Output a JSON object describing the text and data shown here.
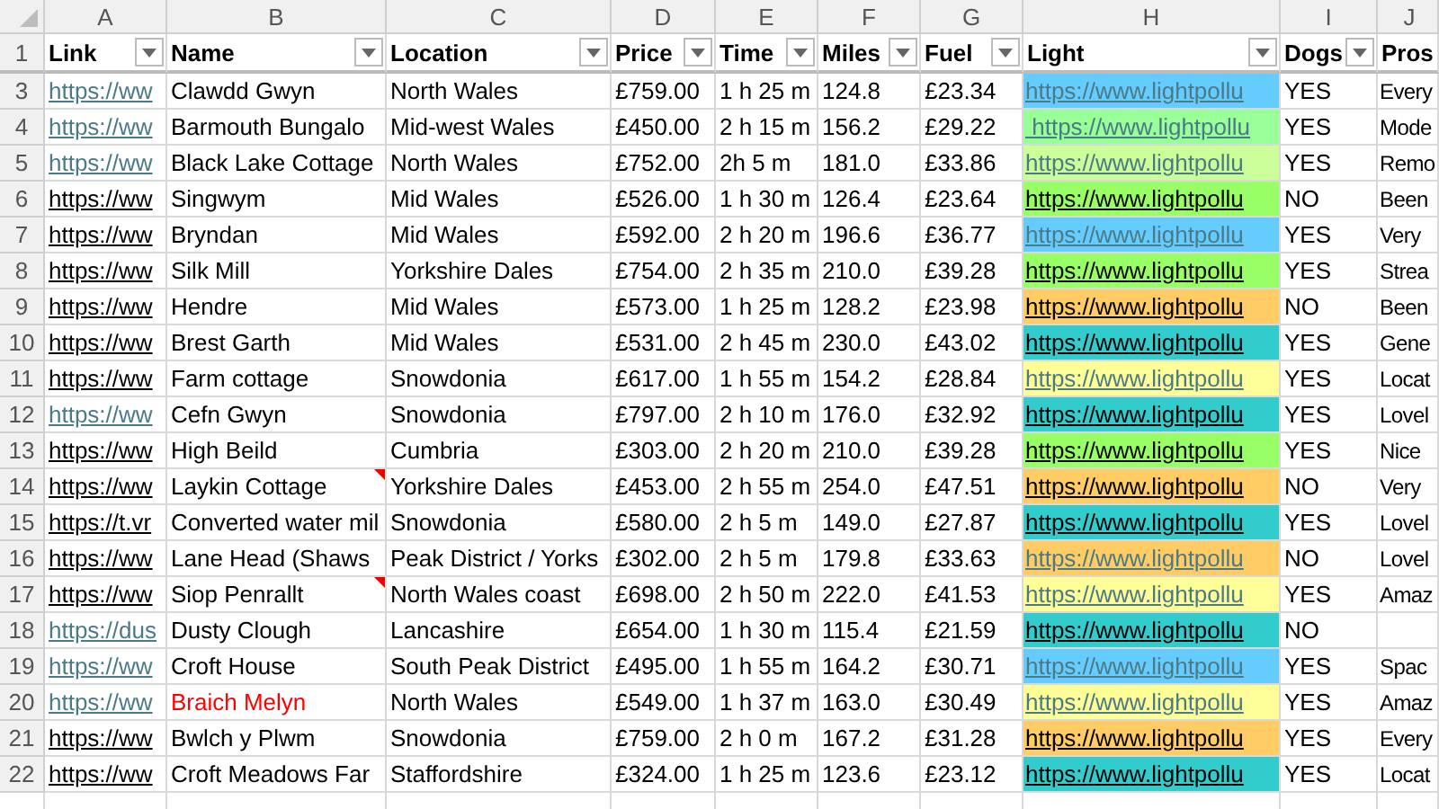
{
  "column_letters": [
    "A",
    "B",
    "C",
    "D",
    "E",
    "F",
    "G",
    "H",
    "I",
    "J"
  ],
  "header_row": {
    "number": "1",
    "columns": [
      {
        "label": "Link",
        "filter_button": true
      },
      {
        "label": "Name",
        "filter_button": true
      },
      {
        "label": "Location",
        "filter_button": true
      },
      {
        "label": "Price",
        "filter_button": true
      },
      {
        "label": "Time",
        "filter_button": true
      },
      {
        "label": "Miles",
        "filter_button": true
      },
      {
        "label": "Fuel",
        "filter_button": true
      },
      {
        "label": "Light",
        "filter_button": true
      },
      {
        "label": "Dogs",
        "filter_button": true
      },
      {
        "label": "Pros",
        "filter_button": false
      }
    ]
  },
  "rows": [
    {
      "number": "3",
      "link": "https://ww",
      "link_visited": true,
      "name": "Clawdd Gwyn",
      "color": "#000000",
      "has_comment": false,
      "location": "North Wales",
      "price": "£759.00",
      "time": "1 h 25 m",
      "miles": "124.8",
      "fuel": "£23.34",
      "light": {
        "text": "https://www.lightpollu",
        "color": "#66ccff",
        "visited": true
      },
      "dogs": "YES",
      "pros": "Every"
    },
    {
      "number": "4",
      "link": "https://ww",
      "link_visited": true,
      "name": "Barmouth Bungalo",
      "color": "#000000",
      "has_comment": false,
      "location": "Mid-west Wales",
      "price": "£450.00",
      "time": "2 h 15 m",
      "miles": "156.2",
      "fuel": "£29.22",
      "light": {
        "text": " https://www.lightpollu",
        "color": "#99ff99",
        "visited": true
      },
      "dogs": "YES",
      "pros": "Mode"
    },
    {
      "number": "5",
      "link": "https://ww",
      "link_visited": true,
      "name": "Black Lake Cottage",
      "color": "#000000",
      "has_comment": false,
      "location": "North Wales",
      "price": "£752.00",
      "time": "2h 5 m",
      "miles": "181.0",
      "fuel": "£33.86",
      "light": {
        "text": "https://www.lightpollu",
        "color": "#ccff99",
        "visited": true
      },
      "dogs": "YES",
      "pros": "Remo"
    },
    {
      "number": "6",
      "link": "https://ww",
      "link_visited": false,
      "name": "Singwym",
      "color": "#000000",
      "has_comment": false,
      "location": "Mid Wales",
      "price": "£526.00",
      "time": "1 h 30 m",
      "miles": "126.4",
      "fuel": "£23.64",
      "light": {
        "text": "https://www.lightpollu",
        "color": "#99ff66",
        "visited": false
      },
      "dogs": "NO",
      "pros": "Been"
    },
    {
      "number": "7",
      "link": "https://ww",
      "link_visited": false,
      "name": "Bryndan",
      "color": "#000000",
      "has_comment": false,
      "location": "Mid Wales",
      "price": "£592.00",
      "time": "2 h 20 m",
      "miles": "196.6",
      "fuel": "£36.77",
      "light": {
        "text": "https://www.lightpollu",
        "color": "#66ccff",
        "visited": true
      },
      "dogs": "YES",
      "pros": "Very"
    },
    {
      "number": "8",
      "link": "https://ww",
      "link_visited": false,
      "name": "Silk Mill",
      "color": "#000000",
      "has_comment": false,
      "location": "Yorkshire Dales",
      "price": "£754.00",
      "time": "2 h 35 m",
      "miles": "210.0",
      "fuel": "£39.28",
      "light": {
        "text": "https://www.lightpollu",
        "color": "#99ff66",
        "visited": false
      },
      "dogs": "YES",
      "pros": "Strea"
    },
    {
      "number": "9",
      "link": "https://ww",
      "link_visited": false,
      "name": "Hendre",
      "color": "#000000",
      "has_comment": false,
      "location": "Mid Wales",
      "price": "£573.00",
      "time": "1 h 25 m",
      "miles": "128.2",
      "fuel": "£23.98",
      "light": {
        "text": "https://www.lightpollu",
        "color": "#ffcc66",
        "visited": false
      },
      "dogs": "NO",
      "pros": "Been"
    },
    {
      "number": "10",
      "link": "https://ww",
      "link_visited": false,
      "name": "Brest Garth",
      "color": "#000000",
      "has_comment": false,
      "location": "Mid Wales",
      "price": "£531.00",
      "time": "2 h 45 m",
      "miles": "230.0",
      "fuel": "£43.02",
      "light": {
        "text": "https://www.lightpollu",
        "color": "#33cccc",
        "visited": false
      },
      "dogs": "YES",
      "pros": "Gene"
    },
    {
      "number": "11",
      "link": "https://ww",
      "link_visited": false,
      "name": "Farm cottage",
      "color": "#000000",
      "has_comment": false,
      "location": "Snowdonia",
      "price": "£617.00",
      "time": "1 h 55 m",
      "miles": "154.2",
      "fuel": "£28.84",
      "light": {
        "text": "https://www.lightpollu",
        "color": "#ffff99",
        "visited": true
      },
      "dogs": "YES",
      "pros": "Locat"
    },
    {
      "number": "12",
      "link": "https://ww",
      "link_visited": true,
      "name": "Cefn Gwyn",
      "color": "#000000",
      "has_comment": false,
      "location": "Snowdonia",
      "price": "£797.00",
      "time": "2 h 10 m",
      "miles": "176.0",
      "fuel": "£32.92",
      "light": {
        "text": "https://www.lightpollu",
        "color": "#33cccc",
        "visited": false
      },
      "dogs": "YES",
      "pros": "Lovel"
    },
    {
      "number": "13",
      "link": "https://ww",
      "link_visited": false,
      "name": "High Beild",
      "color": "#000000",
      "has_comment": false,
      "location": "Cumbria",
      "price": "£303.00",
      "time": "2 h 20 m",
      "miles": "210.0",
      "fuel": "£39.28",
      "light": {
        "text": "https://www.lightpollu",
        "color": "#99ff66",
        "visited": false
      },
      "dogs": "YES",
      "pros": "Nice"
    },
    {
      "number": "14",
      "link": "https://ww",
      "link_visited": false,
      "name": "Laykin Cottage",
      "color": "#000000",
      "has_comment": true,
      "location": "Yorkshire Dales",
      "price": "£453.00",
      "time": "2 h 55 m",
      "miles": "254.0",
      "fuel": "£47.51",
      "light": {
        "text": "https://www.lightpollu",
        "color": "#ffcc66",
        "visited": false
      },
      "dogs": "NO",
      "pros": "Very"
    },
    {
      "number": "15",
      "link": "https://t.vr",
      "link_visited": false,
      "name": "Converted water mil",
      "color": "#000000",
      "has_comment": false,
      "location": "Snowdonia",
      "price": "£580.00",
      "time": "2 h 5 m",
      "miles": "149.0",
      "fuel": "£27.87",
      "light": {
        "text": "https://www.lightpollu",
        "color": "#33cccc",
        "visited": false
      },
      "dogs": "YES",
      "pros": "Lovel"
    },
    {
      "number": "16",
      "link": "https://ww",
      "link_visited": false,
      "name": "Lane Head (Shaws",
      "color": "#000000",
      "has_comment": false,
      "location": "Peak District / Yorks",
      "price": "£302.00",
      "time": "2 h 5 m",
      "miles": "179.8",
      "fuel": "£33.63",
      "light": {
        "text": "https://www.lightpollu",
        "color": "#ffcc66",
        "visited": true
      },
      "dogs": "NO",
      "pros": "Lovel"
    },
    {
      "number": "17",
      "link": "https://ww",
      "link_visited": false,
      "name": "Siop Penrallt",
      "color": "#000000",
      "has_comment": true,
      "location": "North Wales coast",
      "price": "£698.00",
      "time": "2 h 50 m",
      "miles": "222.0",
      "fuel": "£41.53",
      "light": {
        "text": "https://www.lightpollu",
        "color": "#ffff99",
        "visited": true
      },
      "dogs": "YES",
      "pros": "Amaz"
    },
    {
      "number": "18",
      "link": "https://dus",
      "link_visited": true,
      "name": "Dusty Clough",
      "color": "#000000",
      "has_comment": false,
      "location": "Lancashire",
      "price": "£654.00",
      "time": "1 h 30 m",
      "miles": "115.4",
      "fuel": "£21.59",
      "light": {
        "text": "https://www.lightpollu",
        "color": "#33cccc",
        "visited": false
      },
      "dogs": "NO"
    },
    {
      "number": "19",
      "link": "https://ww",
      "link_visited": true,
      "name": "Croft House",
      "color": "#000000",
      "has_comment": false,
      "location": "South Peak District",
      "price": "£495.00",
      "time": "1 h 55 m",
      "miles": "164.2",
      "fuel": "£30.71",
      "light": {
        "text": "https://www.lightpollu",
        "color": "#66ccff",
        "visited": true
      },
      "dogs": "YES",
      "pros": "Spac"
    },
    {
      "number": "20",
      "link": "https://ww",
      "link_visited": true,
      "name": "Braich Melyn",
      "color": "#ff0000",
      "has_comment": false,
      "location": "North Wales",
      "price": "£549.00",
      "time": "1 h 37 m",
      "miles": "163.0",
      "fuel": "£30.49",
      "light": {
        "text": "https://www.lightpollu",
        "color": "#ffff99",
        "visited": true
      },
      "dogs": "YES",
      "pros": "Amaz"
    },
    {
      "number": "21",
      "link": "https://ww",
      "link_visited": false,
      "name": "Bwlch y Plwm",
      "color": "#000000",
      "has_comment": false,
      "location": "Snowdonia",
      "price": "£759.00",
      "time": "2 h 0 m",
      "miles": "167.2",
      "fuel": "£31.28",
      "light": {
        "text": "https://www.lightpollu",
        "color": "#ffcc66",
        "visited": false
      },
      "dogs": "YES",
      "pros": "Every"
    },
    {
      "number": "22",
      "link": "https://ww",
      "link_visited": false,
      "name": "Croft Meadows Far",
      "color": "#000000",
      "has_comment": false,
      "location": "Staffordshire",
      "price": "£324.00",
      "time": "1 h 25 m",
      "miles": "123.6",
      "fuel": "£23.12",
      "light": {
        "text": "https://www.lightpollu",
        "color": "#33cccc",
        "visited": false
      },
      "dogs": "YES",
      "pros": "Locat"
    }
  ]
}
